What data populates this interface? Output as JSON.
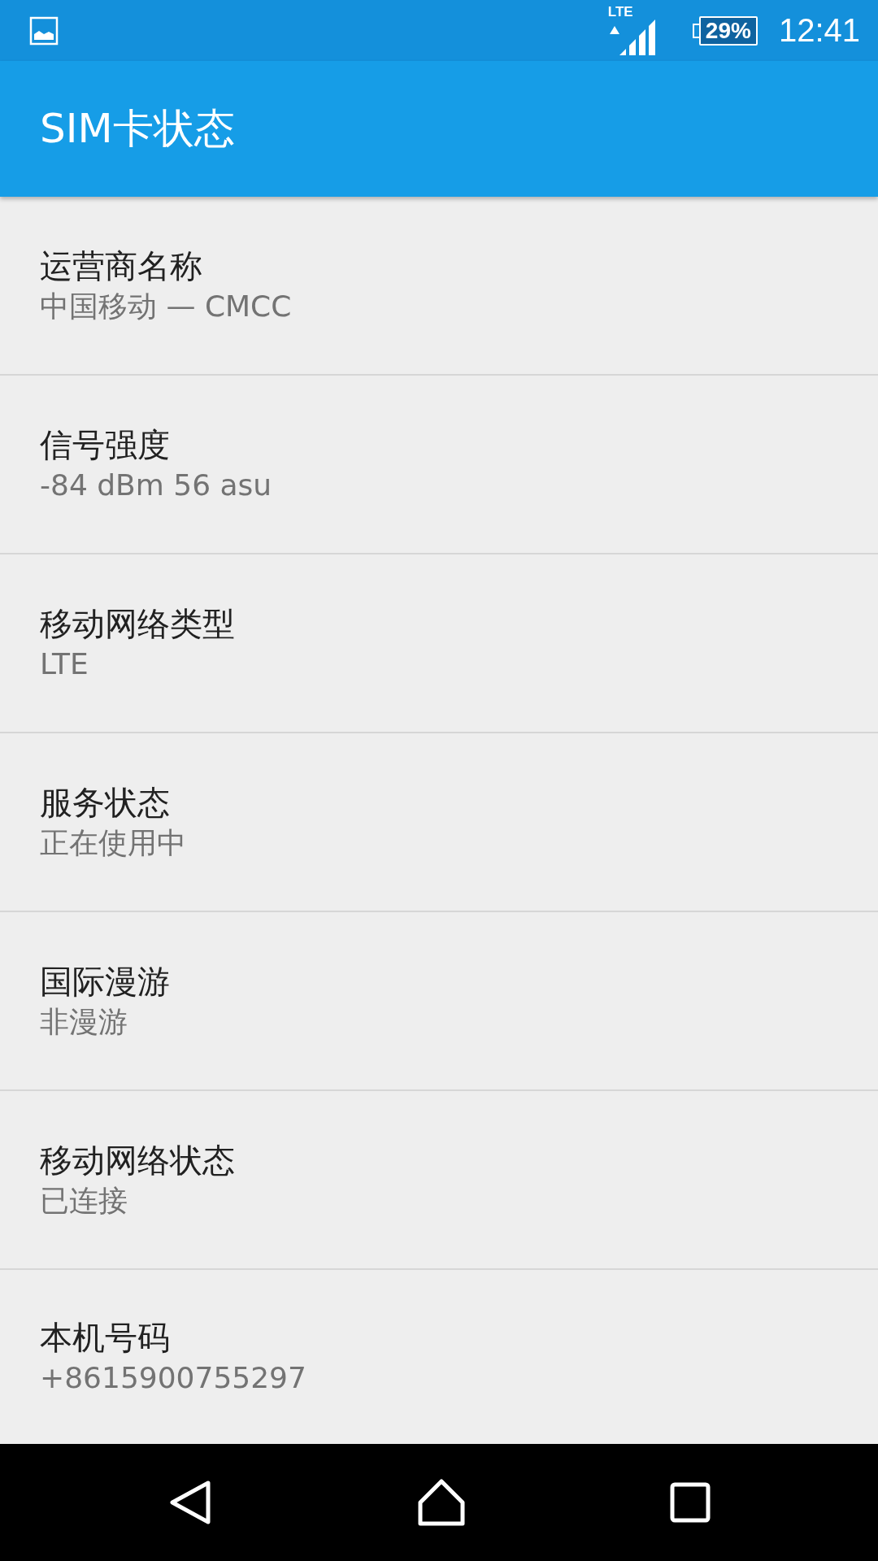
{
  "status_bar": {
    "network": "LTE",
    "battery": "29%",
    "time": "12:41"
  },
  "app_bar": {
    "title": "SIM卡状态"
  },
  "items": [
    {
      "title": "运营商名称",
      "summary": "中国移动 — CMCC"
    },
    {
      "title": "信号强度",
      "summary": "-84 dBm 56 asu"
    },
    {
      "title": "移动网络类型",
      "summary": "LTE"
    },
    {
      "title": "服务状态",
      "summary": "正在使用中"
    },
    {
      "title": "国际漫游",
      "summary": "非漫游"
    },
    {
      "title": "移动网络状态",
      "summary": "已连接"
    },
    {
      "title": "本机号码",
      "summary": "+8615900755297"
    }
  ]
}
